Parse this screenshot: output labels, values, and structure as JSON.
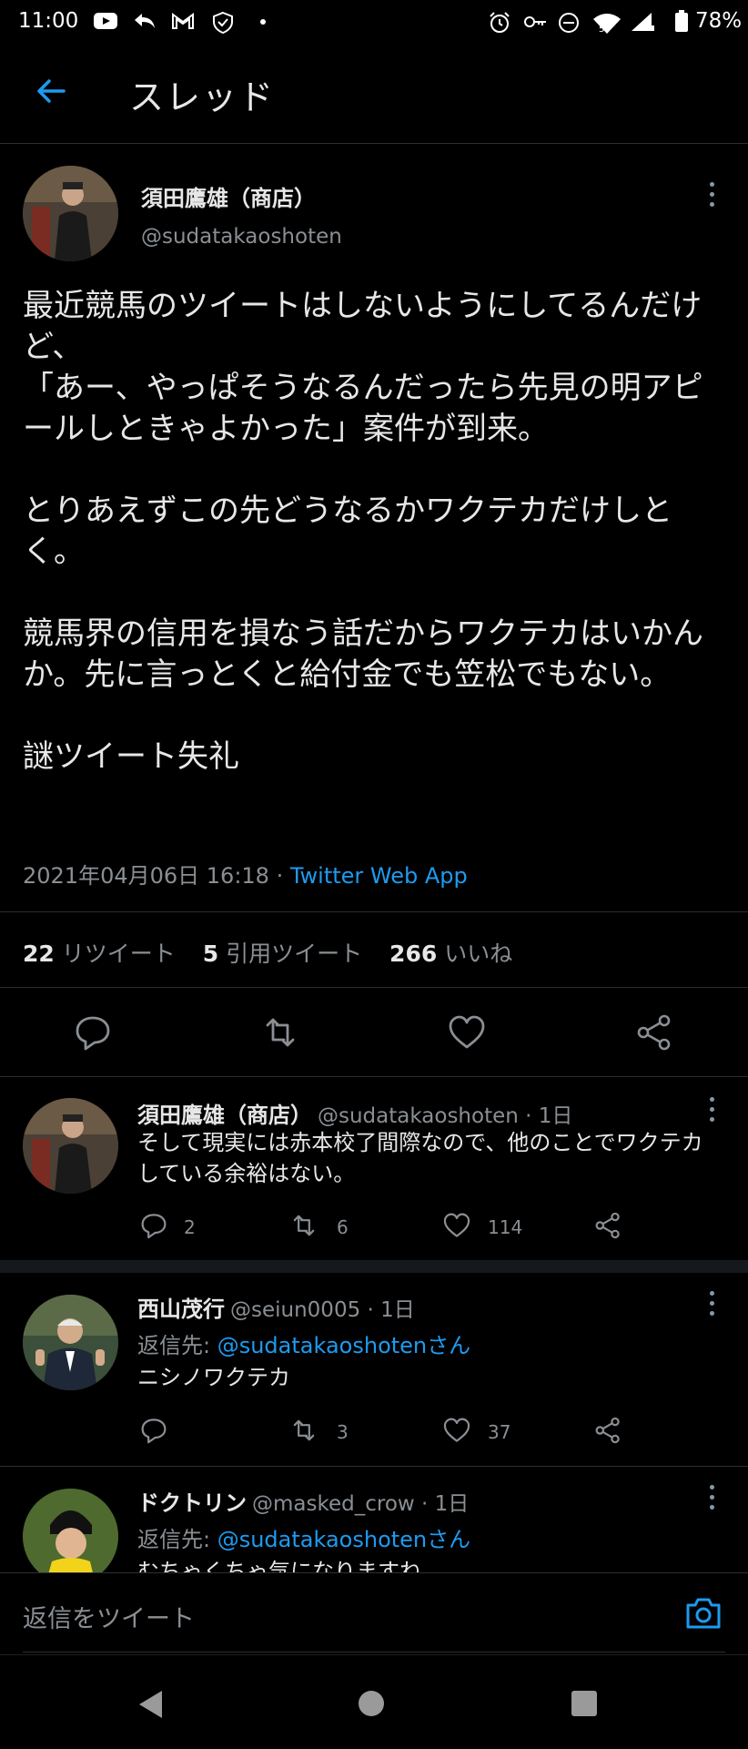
{
  "status": {
    "time": "11:00",
    "battery": "78%",
    "signal_small": "5"
  },
  "header": {
    "title": "スレッド"
  },
  "main_tweet": {
    "name": "須田鷹雄（商店）",
    "handle": "@sudatakaoshoten",
    "text": "最近競馬のツイートはしないようにしてるんだけど、\n「あー、やっぱそうなるんだったら先見の明アピールしときゃよかった」案件が到来。\n\nとりあえずこの先どうなるかワクテカだけしとく。\n\n競馬界の信用を損なう話だからワクテカはいかんか。先に言っとくと給付金でも笠松でもない。\n\n謎ツイート失礼",
    "date": "2021年04月06日 16:18",
    "separator": " · ",
    "via": "Twitter Web App",
    "retweets_count": "22",
    "retweets_label": "リツイート",
    "quotes_count": "5",
    "quotes_label": "引用ツイート",
    "likes_count": "266",
    "likes_label": "いいね"
  },
  "replies": [
    {
      "name": "須田鷹雄（商店）",
      "handle": "@sudatakaoshoten · 1日",
      "text": "そして現実には赤本校了間際なので、他のことでワクテカしている余裕はない。",
      "reply_count": "2",
      "retweet_count": "6",
      "like_count": "114"
    },
    {
      "name": "西山茂行",
      "handle": "@seiun0005 · 1日",
      "reply_to_label": "返信先: ",
      "reply_to_user": "@sudatakaoshotenさん",
      "text": "ニシノワクテカ",
      "reply_count": "",
      "retweet_count": "3",
      "like_count": "37"
    },
    {
      "name": "ドクトリン",
      "handle": "@masked_crow · 1日",
      "reply_to_label": "返信先: ",
      "reply_to_user": "@sudatakaoshotenさん",
      "text": "むちゃくちゃ気になりますね"
    }
  ],
  "composer": {
    "placeholder": "返信をツイート"
  },
  "colors": {
    "background": "#000000",
    "accent": "#1d9bf0",
    "secondary_text": "#8a8f94"
  }
}
